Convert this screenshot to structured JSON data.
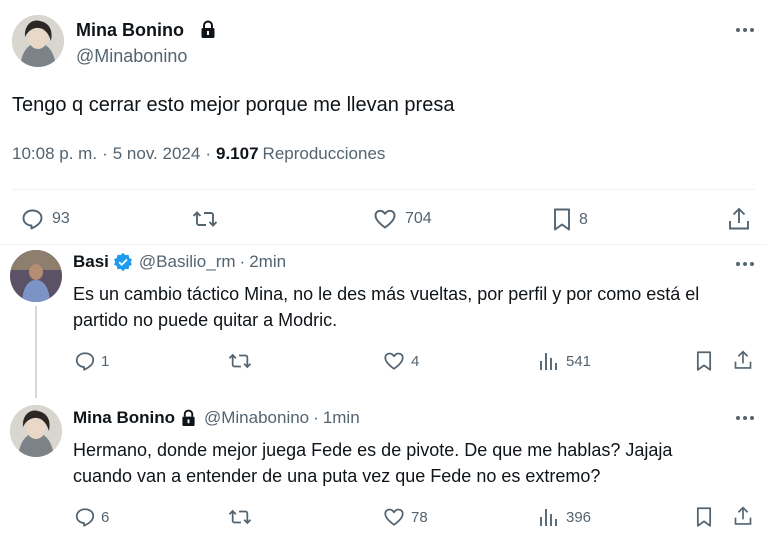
{
  "main_tweet": {
    "author_name": "Mina Bonino",
    "handle": "@Minabonino",
    "text": "Tengo q cerrar esto mejor porque me llevan presa",
    "time": "10:08 p. m.",
    "date": "5 nov. 2024",
    "separator": "·",
    "views_count": "9.107",
    "views_label": "Reproducciones",
    "replies": "93",
    "likes": "704",
    "bookmarks": "8"
  },
  "replies": [
    {
      "author_name": "Basi",
      "handle": "@Basilio_rm",
      "time": "2min",
      "text": "Es un cambio táctico Mina, no le des más vueltas, por perfil y por como está el partido no puede quitar a Modric.",
      "replies": "1",
      "likes": "4",
      "views": "541"
    },
    {
      "author_name": "Mina Bonino",
      "handle": "@Minabonino",
      "time": "1min",
      "text": "Hermano, donde mejor juega Fede es de pivote. De que me hablas? Jajaja cuando van a entender de una puta vez que Fede no es extremo?",
      "replies": "6",
      "likes": "78",
      "views": "396"
    }
  ],
  "icons": {
    "reply": "reply-icon",
    "retweet": "retweet-icon",
    "like": "heart-icon",
    "bookmark": "bookmark-icon",
    "share": "share-icon",
    "views": "views-icon",
    "more": "more-icon",
    "lock": "lock-icon",
    "verified": "verified-badge-icon"
  },
  "colors": {
    "text": "#0f1419",
    "muted": "#536471",
    "verified": "#1d9bf0",
    "divider": "#eff3f4"
  }
}
